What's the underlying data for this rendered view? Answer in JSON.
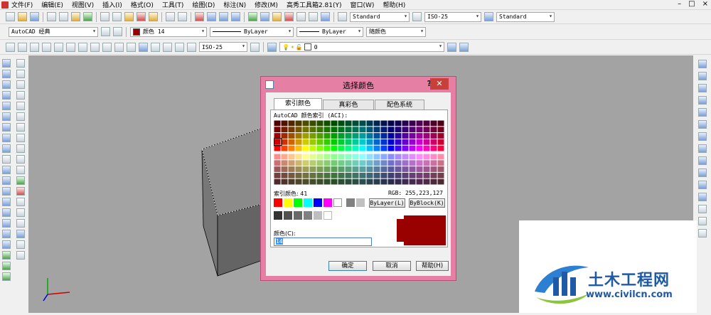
{
  "menubar": {
    "items": [
      "文件(F)",
      "编辑(E)",
      "视图(V)",
      "插入(I)",
      "格式(O)",
      "工具(T)",
      "绘图(D)",
      "标注(N)",
      "修改(M)",
      "高秀工具箱2.81(Y)",
      "窗口(W)",
      "帮助(H)"
    ],
    "window_controls": [
      "–",
      "□",
      "×"
    ]
  },
  "toolbar1": {
    "text_style": "Standard",
    "dim_style": "ISO-25",
    "table_style": "Standard"
  },
  "toolbar2": {
    "workspace": "AutoCAD 经典",
    "color": "颜色 14",
    "color_hex": "#990000",
    "linetype": "ByLayer",
    "lineweight": "ByLayer",
    "plotstyle": "随颜色"
  },
  "toolbar3": {
    "dim_style": "ISO-25",
    "layer": "0"
  },
  "dialog": {
    "title": "选择颜色",
    "help_glyph": "?",
    "close_glyph": "✕",
    "tabs": [
      "索引颜色",
      "真彩色",
      "配色系统"
    ],
    "aci_label": "AutoCAD 颜色索引 (ACI):",
    "index_label": "索引颜色: 41",
    "rgb_label": "RGB: 255,223,127",
    "bylayer_button": "ByLayer(L)",
    "byblock_button": "ByBlock(K)",
    "color_label": "颜色(C):",
    "color_value": "14",
    "selected_color_hex": "#990000",
    "standard_colors": [
      "#ff0000",
      "#ffff00",
      "#00ff00",
      "#00ffff",
      "#0000ff",
      "#ff00ff",
      "#ffffff"
    ],
    "standard_greys": [
      "#808080",
      "#c0c0c0"
    ],
    "grey_ramp": [
      "#333333",
      "#505050",
      "#696969",
      "#808080",
      "#bebebe",
      "#ffffff"
    ],
    "ok_button": "确定",
    "cancel_button": "取消",
    "help_button": "帮助(H)"
  },
  "watermark": {
    "text": "土木工程网",
    "url": "www.civilcn.com"
  }
}
